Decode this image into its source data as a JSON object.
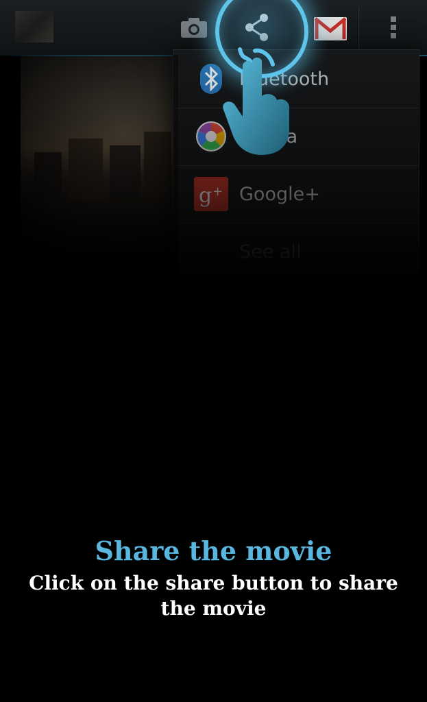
{
  "tutorial": {
    "title": "Share the movie",
    "description": "Click on the share button to share the movie"
  },
  "actionbar": {
    "icons": [
      "camera-icon",
      "share-icon",
      "gmail-icon",
      "overflow-menu-icon"
    ]
  },
  "share_menu": {
    "items": [
      {
        "label": "Bluetooth",
        "icon": "bluetooth-icon"
      },
      {
        "label": "Picasa",
        "icon": "picasa-icon"
      },
      {
        "label": "Google+",
        "icon": "google-plus-icon"
      },
      {
        "label": "See all",
        "icon": ""
      }
    ]
  },
  "colors": {
    "accent": "#59b6df",
    "ring": "#5fc4ea",
    "background": "#000000",
    "caption_text": "#ffffff"
  }
}
